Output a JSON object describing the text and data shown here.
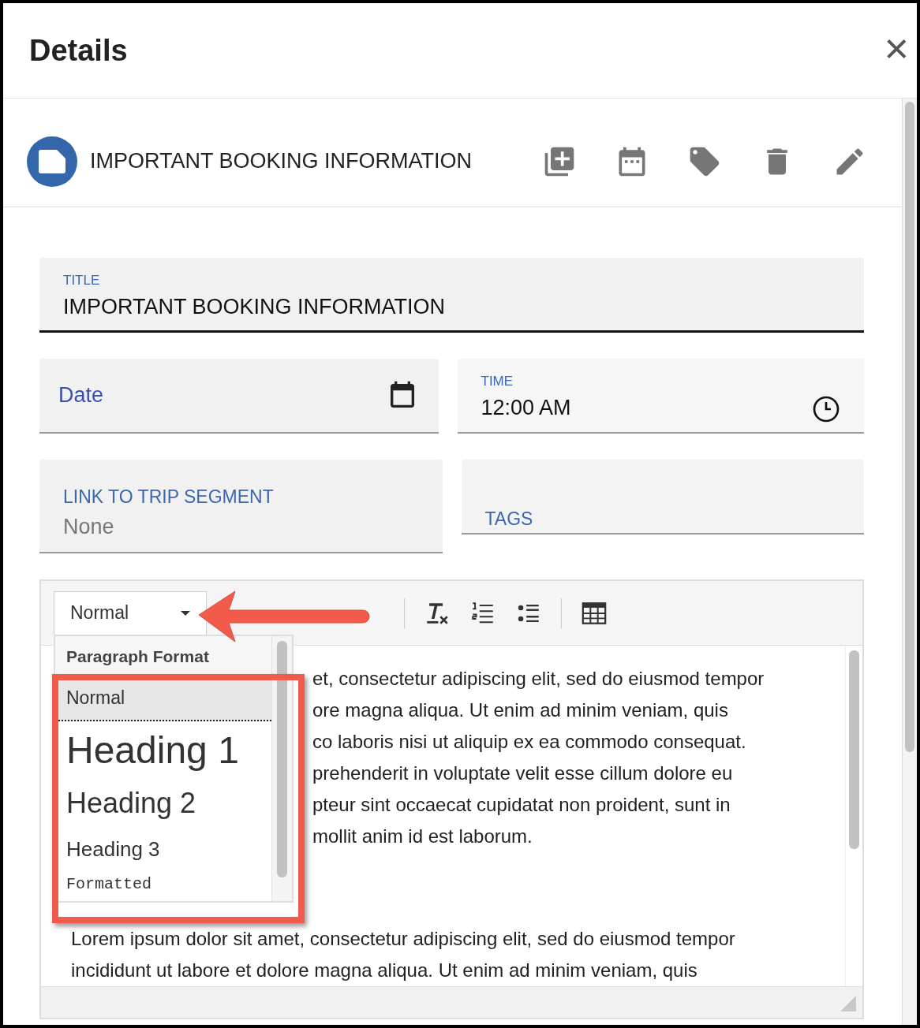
{
  "dialog": {
    "title": "Details",
    "close": "×"
  },
  "note": {
    "title": "IMPORTANT BOOKING INFORMATION"
  },
  "fields": [
    {
      "kind": "text",
      "label": "TITLE",
      "value": "IMPORTANT BOOKING INFORMATION",
      "focused": true
    },
    {
      "kind": "date",
      "placeholder": "Date",
      "focused": false
    },
    {
      "kind": "time",
      "label": "TIME",
      "value": "12:00 AM",
      "focused": false
    },
    {
      "kind": "select",
      "label": "LINK TO TRIP SEGMENT",
      "value": "None",
      "focused": false
    },
    {
      "kind": "tags",
      "label": "TAGS",
      "focused": false
    }
  ],
  "editor": {
    "format_select": "Normal",
    "menu": {
      "header": "Paragraph Format",
      "items": [
        {
          "kind": "normal",
          "label": "Normal",
          "selected": true
        },
        {
          "kind": "h1",
          "label": "Heading 1",
          "selected": false
        },
        {
          "kind": "h2",
          "label": "Heading 2",
          "selected": false
        },
        {
          "kind": "h3",
          "label": "Heading 3",
          "selected": false
        },
        {
          "kind": "pre",
          "label": "Formatted",
          "selected": false
        }
      ]
    },
    "paragraphs": [
      {
        "lines": [
          "et, consectetur adipiscing elit, sed do eiusmod tempor",
          "ore magna aliqua. Ut enim ad minim veniam, quis",
          "co laboris nisi ut aliquip ex ea commodo consequat.",
          "prehenderit in voluptate velit esse cillum dolore eu",
          "pteur sint occaecat cupidatat non proident, sunt in",
          "mollit anim id est laborum."
        ]
      },
      {
        "lines": [
          "Lorem ipsum dolor sit amet, consectetur adipiscing elit, sed do eiusmod tempor",
          "incididunt ut labore et dolore magna aliqua. Ut enim ad minim veniam, quis"
        ]
      }
    ]
  }
}
